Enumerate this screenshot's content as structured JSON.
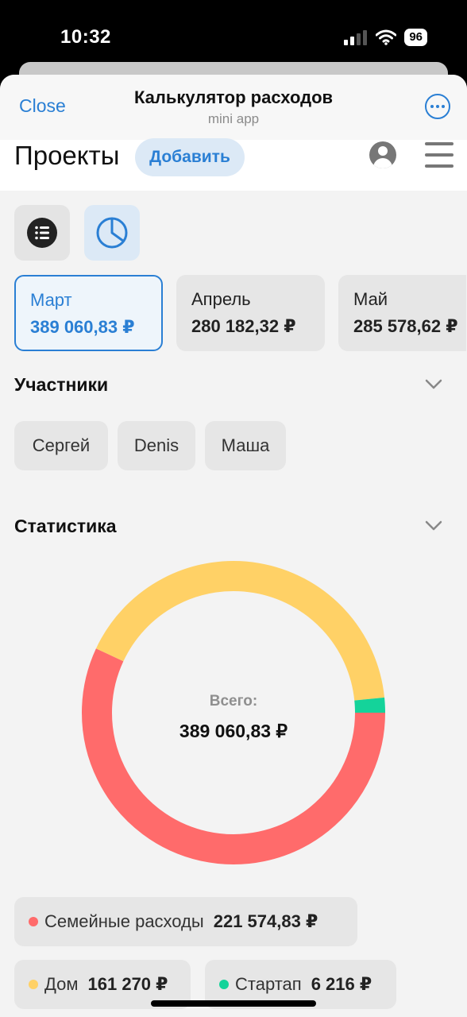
{
  "status_bar": {
    "time": "10:32",
    "battery": "96"
  },
  "header": {
    "close_label": "Close",
    "title": "Калькулятор расходов",
    "subtitle": "mini app"
  },
  "page": {
    "title": "Проекты",
    "add_label": "Добавить"
  },
  "months": [
    {
      "name": "Март",
      "total": "389 060,83 ₽",
      "active": true
    },
    {
      "name": "Апрель",
      "total": "280 182,32 ₽",
      "active": false
    },
    {
      "name": "Май",
      "total": "285 578,62 ₽",
      "active": false
    }
  ],
  "participants": {
    "title": "Участники",
    "items": [
      "Сергей",
      "Denis",
      "Маша"
    ]
  },
  "statistics": {
    "title": "Статистика",
    "total_label": "Всего:",
    "total_value": "389 060,83 ₽",
    "categories": [
      {
        "name": "Семейные расходы",
        "value": "221 574,83 ₽",
        "amount": 221574.83,
        "color": "#ff6b6b"
      },
      {
        "name": "Дом",
        "value": "161 270 ₽",
        "amount": 161270,
        "color": "#ffd166"
      },
      {
        "name": "Стартап",
        "value": "6 216 ₽",
        "amount": 6216,
        "color": "#14d39a"
      }
    ]
  },
  "colors": {
    "accent": "#2a7fd4"
  }
}
